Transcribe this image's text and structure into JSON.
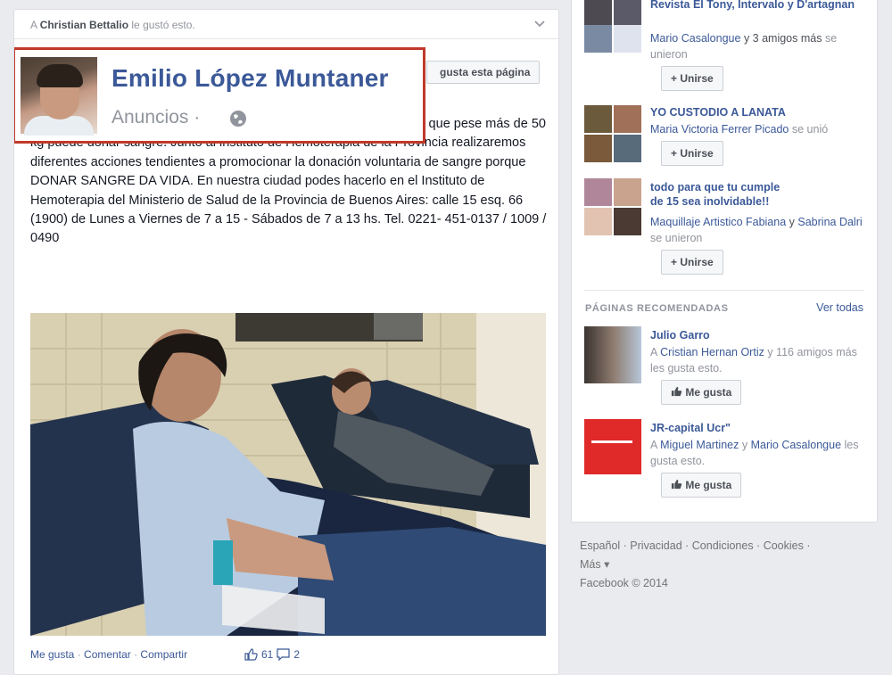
{
  "post": {
    "liked_by": "Christian Bettalio",
    "liked_prefix": "A",
    "liked_suffix": "le gustó esto.",
    "page_name": "Emilio López Muntaner",
    "sponsored": "Anuncios",
    "sponsored_dot": "·",
    "like_page_btn": "gusta esta página",
    "text": "rsona con buen estado de salud, mayor de 18 años y menor de 65, y que pese más de 50 kg puede donar sangre. Junto al instituto de Hemoterapia de la Provincia realizaremos diferentes acciones tendientes a promocionar la donación voluntaria de sangre porque DONAR SANGRE DA VIDA. En nuestra ciudad podes hacerlo en el Instituto de Hemoterapia del Ministerio de Salud de la Provincia de Buenos Aires: calle 15 esq. 66 (1900) de Lunes a Viernes de 7 a 15 - Sábados de 7 a 13 hs. Tel. 0221- 451-0137 / 1009 / 0490",
    "actions": {
      "like": "Me gusta",
      "comment": "Comentar",
      "share": "Compartir"
    },
    "likes_count": "61",
    "comments_count": "2"
  },
  "sidebar": {
    "groups": [
      {
        "title": "Revista El Tony, Intervalo y D'artagnan",
        "member": "Mario Casalongue",
        "rest": "y 3 amigos más",
        "tail": "se unieron",
        "button": "+ Unirse"
      },
      {
        "title": "YO CUSTODIO A LANATA",
        "member": "Maria Victoria Ferrer Picado",
        "rest": "",
        "tail": "se unió",
        "button": "+ Unirse"
      },
      {
        "title": "todo para que tu cumple de 15 sea inolvidable!!",
        "member": "Maquillaje Artistico Fabiana",
        "rest": "y",
        "member2": "Sabrina Dalri",
        "tail": "se unieron",
        "button": "+ Unirse"
      }
    ],
    "recommended_heading": "PÁGINAS RECOMENDADAS",
    "see_all": "Ver todas",
    "pages": [
      {
        "name": "Julio Garro",
        "prefix": "A",
        "friend": "Cristian Hernan Ortiz",
        "rest": "y 116 amigos más les gusta esto.",
        "button": "Me gusta"
      },
      {
        "name": "JR-capital Ucr\"",
        "prefix": "A",
        "friend": "Miguel Martinez",
        "rest": "y",
        "friend2": "Mario Casalongue",
        "tail": "les gusta esto.",
        "button": "Me gusta"
      }
    ]
  },
  "footer": {
    "links": [
      "Español",
      "Privacidad",
      "Condiciones",
      "Cookies",
      "Más"
    ],
    "copyright": "Facebook © 2014"
  },
  "colors": {
    "link": "#3b5998",
    "highlight_border": "#c0392b",
    "background": "#e9ebee"
  }
}
